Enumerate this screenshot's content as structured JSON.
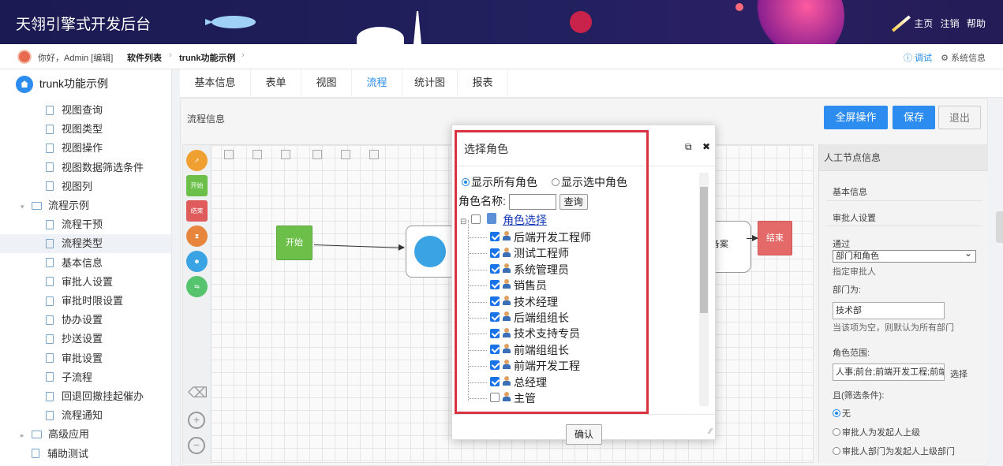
{
  "header": {
    "app_title": "天翎引擎式开发后台",
    "links": [
      "主页",
      "注销",
      "帮助"
    ]
  },
  "crumbbar": {
    "greeting": "你好，Admin [编辑]",
    "crumbs": [
      "软件列表",
      "trunk功能示例"
    ],
    "debug": "调试",
    "sysinfo": "系统信息"
  },
  "sidebar": {
    "root": "trunk功能示例",
    "items": [
      {
        "label": "视图查询",
        "type": "doc",
        "indent": 2
      },
      {
        "label": "视图类型",
        "type": "doc",
        "indent": 2
      },
      {
        "label": "视图操作",
        "type": "doc",
        "indent": 2
      },
      {
        "label": "视图数据筛选条件",
        "type": "doc",
        "indent": 2
      },
      {
        "label": "视图列",
        "type": "doc",
        "indent": 2
      },
      {
        "label": "流程示例",
        "type": "folder-open",
        "indent": 1
      },
      {
        "label": "流程干预",
        "type": "doc",
        "indent": 2
      },
      {
        "label": "流程类型",
        "type": "doc",
        "indent": 2,
        "active": true
      },
      {
        "label": "基本信息",
        "type": "doc",
        "indent": 2
      },
      {
        "label": "审批人设置",
        "type": "doc",
        "indent": 2
      },
      {
        "label": "审批时限设置",
        "type": "doc",
        "indent": 2
      },
      {
        "label": "协办设置",
        "type": "doc",
        "indent": 2
      },
      {
        "label": "抄送设置",
        "type": "doc",
        "indent": 2
      },
      {
        "label": "审批设置",
        "type": "doc",
        "indent": 2
      },
      {
        "label": "子流程",
        "type": "doc",
        "indent": 2
      },
      {
        "label": "回退回撤挂起催办",
        "type": "doc",
        "indent": 2
      },
      {
        "label": "流程通知",
        "type": "doc",
        "indent": 2
      },
      {
        "label": "高级应用",
        "type": "folder",
        "indent": 1
      },
      {
        "label": "辅助测试",
        "type": "doc",
        "indent": 1
      }
    ]
  },
  "tabs": [
    {
      "label": "基本信息"
    },
    {
      "label": "表单"
    },
    {
      "label": "视图"
    },
    {
      "label": "流程",
      "active": true
    },
    {
      "label": "统计图"
    },
    {
      "label": "报表"
    }
  ],
  "panel": {
    "title": "流程信息",
    "btn_fullscreen": "全屏操作",
    "btn_save": "保存",
    "btn_exit": "退出"
  },
  "canvas": {
    "tools": [
      "开始",
      "结束"
    ],
    "node_start": "开始",
    "node_archive": "备案",
    "node_end": "结束"
  },
  "props": {
    "header": "人工节点信息",
    "basic": "基本信息",
    "approver_settings": "审批人设置",
    "via_label": "通过",
    "via_value": "部门和角色",
    "assign_label": "指定审批人",
    "dept_label": "部门为:",
    "dept_value": "技术部",
    "dept_hint": "当该项为空，则默认为所有部门",
    "role_range_label": "角色范围:",
    "role_range_value": "人事;前台;前端开发工程;前端",
    "choose": "选择",
    "filter_label": "且(筛选条件):",
    "filter_none": "无",
    "filter_opt1": "审批人为发起人上级",
    "filter_opt2": "审批人部门为发起人上级部门"
  },
  "dialog": {
    "title": "选择角色",
    "radio_all": "显示所有角色",
    "radio_selected": "显示选中角色",
    "name_label": "角色名称:",
    "query_btn": "查询",
    "group_label": "角色选择",
    "roles": [
      {
        "name": "后端开发工程师",
        "checked": true
      },
      {
        "name": "测试工程师",
        "checked": true
      },
      {
        "name": "系统管理员",
        "checked": true
      },
      {
        "name": "销售员",
        "checked": true
      },
      {
        "name": "技术经理",
        "checked": true
      },
      {
        "name": "后端组组长",
        "checked": true
      },
      {
        "name": "技术支持专员",
        "checked": true
      },
      {
        "name": "前端组组长",
        "checked": true
      },
      {
        "name": "前端开发工程",
        "checked": true
      },
      {
        "name": "总经理",
        "checked": true
      },
      {
        "name": "主管",
        "checked": false
      }
    ],
    "confirm": "确认"
  },
  "colors": {
    "primary": "#2d8cf0",
    "highlight_frame": "#d6323f",
    "header_bg": "#1c1a52"
  }
}
